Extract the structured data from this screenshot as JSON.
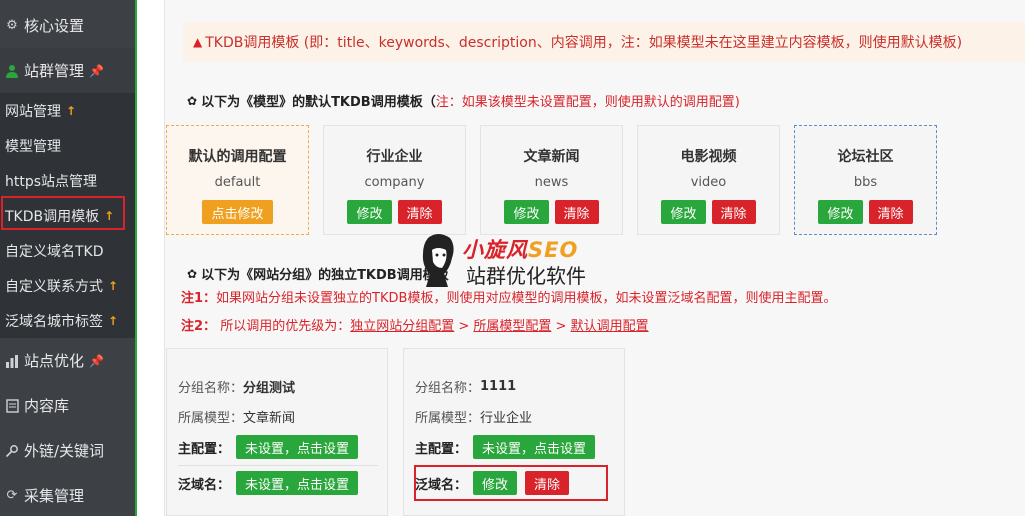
{
  "sidebar": {
    "groups": [
      {
        "label": "核心设置"
      },
      {
        "label": "站群管理"
      },
      {
        "label": "站点优化"
      },
      {
        "label": "内容库"
      },
      {
        "label": "外链/关键词"
      },
      {
        "label": "采集管理"
      }
    ],
    "sub_items": [
      {
        "label": "网站管理"
      },
      {
        "label": "模型管理"
      },
      {
        "label": "https站点管理"
      },
      {
        "label": "TKDB调用模板"
      },
      {
        "label": "自定义域名TKD"
      },
      {
        "label": "自定义联系方式"
      },
      {
        "label": "泛域名城市标签"
      }
    ],
    "accent_color": "#2aa73c"
  },
  "alert": {
    "text": "TKDB调用模板 (即：title、keywords、description、内容调用，注：如果模型未在这里建立内容模板，则使用默认模板)"
  },
  "model_section": {
    "title": "以下为《模型》的默认TKDB调用模板（",
    "note": "注：如果该模型未设置配置，则使用默认的调用配置)",
    "cards": [
      {
        "title": "默认的调用配置",
        "value": "default",
        "edit_label": "点击修改"
      },
      {
        "title": "行业企业",
        "value": "company",
        "edit_label": "修改",
        "clear_label": "清除"
      },
      {
        "title": "文章新闻",
        "value": "news",
        "edit_label": "修改",
        "clear_label": "清除"
      },
      {
        "title": "电影视频",
        "value": "video",
        "edit_label": "修改",
        "clear_label": "清除"
      },
      {
        "title": "论坛社区",
        "value": "bbs",
        "edit_label": "修改",
        "clear_label": "清除"
      }
    ]
  },
  "group_section": {
    "title": "以下为《网站分组》的独立TKDB调用模板",
    "note1_label": "注1：",
    "note1_text": "如果网站分组未设置独立的TKDB模板，则使用对应模型的调用模板，如未设置泛域名配置，则使用主配置。",
    "note2_label": "注2：",
    "note2_prefix": "所以调用的优先级为：",
    "note2_link1": "独立网站分组配置",
    "note2_sep": " > ",
    "note2_link2": "所属模型配置",
    "note2_link3": "默认调用配置",
    "cards": [
      {
        "group_label": "分组名称：",
        "group_name": "分组测试",
        "model_label": "所属模型：",
        "model_name": "文章新闻",
        "main_label": "主配置：",
        "main_btn": "未设置，点击设置",
        "wild_label": "泛域名：",
        "wild_btn": "未设置，点击设置"
      },
      {
        "group_label": "分组名称：",
        "group_name": "1111",
        "model_label": "所属模型：",
        "model_name": "行业企业",
        "main_label": "主配置：",
        "main_btn": "未设置，点击设置",
        "wild_label": "泛域名：",
        "wild_edit": "修改",
        "wild_clear": "清除"
      }
    ]
  },
  "watermark": {
    "brand_top": "小旋风",
    "brand_seo": "SEO",
    "brand_bottom": "站群优化软件"
  }
}
